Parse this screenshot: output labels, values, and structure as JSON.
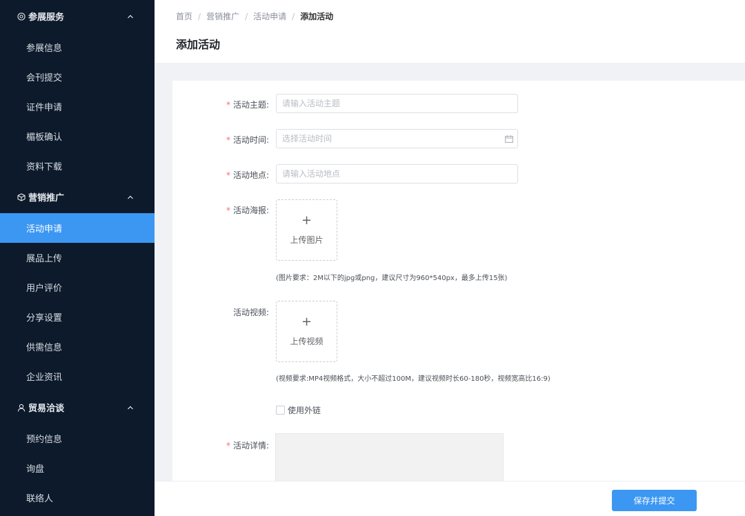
{
  "sidebar": {
    "groups": [
      {
        "label": "参展服务",
        "icon": "target-icon",
        "items": [
          "参展信息",
          "会刊提交",
          "证件申请",
          "楣板确认",
          "资料下载"
        ]
      },
      {
        "label": "营销推广",
        "icon": "box-icon",
        "items": [
          "活动申请",
          "展品上传",
          "用户评价",
          "分享设置",
          "供需信息",
          "企业资讯"
        ]
      },
      {
        "label": "贸易洽谈",
        "icon": "user-icon",
        "items": [
          "预约信息",
          "询盘",
          "联络人"
        ]
      }
    ],
    "active_item": "活动申请"
  },
  "breadcrumb": [
    "首页",
    "营销推广",
    "活动申请",
    "添加活动"
  ],
  "page_title": "添加活动",
  "form": {
    "subject": {
      "label": "活动主题:",
      "placeholder": "请输入活动主题"
    },
    "time": {
      "label": "活动时间:",
      "placeholder": "选择活动时间"
    },
    "location": {
      "label": "活动地点:",
      "placeholder": "请输入活动地点"
    },
    "poster": {
      "label": "活动海报:",
      "upload_label": "上传图片",
      "hint": "(图片要求：2M以下的jpg或png，建议尺寸为960*540px，最多上传15张)"
    },
    "video": {
      "label": "活动视频:",
      "upload_label": "上传视频",
      "hint": "(视频要求:MP4视频格式，大小不超过100M，建议视频时长60-180秒，视频宽高比16:9)"
    },
    "external_link": {
      "label": "使用外链"
    },
    "details": {
      "label": "活动详情:"
    }
  },
  "footer": {
    "submit_label": "保存并提交"
  },
  "colors": {
    "sidebar_bg": "#0c1a2b",
    "accent": "#3c97f3",
    "required": "#f56c6c"
  }
}
